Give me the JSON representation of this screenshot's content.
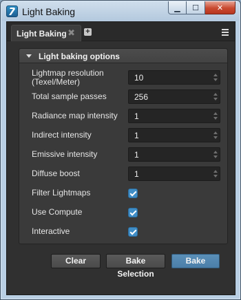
{
  "window": {
    "title": "Light Baking",
    "minimize_glyph": "▁",
    "maximize_glyph": "☐",
    "close_glyph": "✕"
  },
  "tab": {
    "label": "Light Baking",
    "close_glyph": "✖",
    "add_glyph": "+"
  },
  "panel": {
    "title": "Light baking options"
  },
  "fields": [
    {
      "label": "Lightmap resolution (Texel/Meter)",
      "value": "10"
    },
    {
      "label": "Total sample passes",
      "value": "256"
    },
    {
      "label": "Radiance map intensity",
      "value": "1"
    },
    {
      "label": "Indirect intensity",
      "value": "1"
    },
    {
      "label": "Emissive intensity",
      "value": "1"
    },
    {
      "label": "Diffuse boost",
      "value": "1"
    }
  ],
  "checkboxes": [
    {
      "label": "Filter Lightmaps",
      "checked": true
    },
    {
      "label": "Use Compute",
      "checked": true
    },
    {
      "label": "Interactive",
      "checked": true
    }
  ],
  "buttons": {
    "clear": "Clear",
    "bake_selection": "Bake Selection",
    "bake": "Bake"
  },
  "colors": {
    "accent": "#3f8dc6",
    "primary_button": "#4b7ea8",
    "panel_bg": "#3a3a3a"
  },
  "icons": {
    "app": "stingray-logo-icon",
    "panel_caret": "caret-down-icon",
    "tab_menu": "hamburger-menu-icon"
  }
}
